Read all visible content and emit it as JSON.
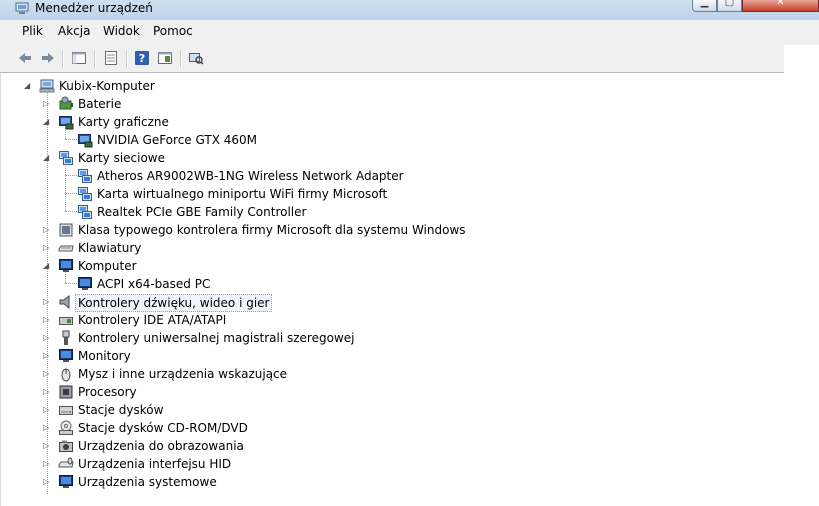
{
  "window": {
    "title": "Menedżer urządzeń"
  },
  "menu": {
    "file": "Plik",
    "action": "Akcja",
    "view": "Widok",
    "help": "Pomoc"
  },
  "toolbar": {
    "back": "back-arrow-icon",
    "forward": "forward-arrow-icon",
    "console_tree": "console-tree-icon",
    "properties": "properties-icon",
    "help": "help-icon",
    "show_hidden": "show-hidden-icon",
    "scan": "scan-hardware-icon"
  },
  "tree": {
    "root": "Kubix-Komputer",
    "categories": [
      {
        "label": "Baterie",
        "icon": "battery-icon",
        "expanded": false
      },
      {
        "label": "Karty graficzne",
        "icon": "display-adapter-icon",
        "expanded": true,
        "children": [
          {
            "label": "NVIDIA GeForce GTX 460M",
            "icon": "display-adapter-icon"
          }
        ]
      },
      {
        "label": "Karty sieciowe",
        "icon": "network-adapter-icon",
        "expanded": true,
        "children": [
          {
            "label": "Atheros AR9002WB-1NG Wireless Network Adapter",
            "icon": "network-adapter-icon"
          },
          {
            "label": "Karta wirtualnego miniportu WiFi firmy Microsoft",
            "icon": "network-adapter-icon"
          },
          {
            "label": "Realtek PCIe GBE Family Controller",
            "icon": "network-adapter-icon"
          }
        ]
      },
      {
        "label": "Klasa typowego kontrolera firmy Microsoft dla systemu Windows",
        "icon": "controller-icon",
        "expanded": false
      },
      {
        "label": "Klawiatury",
        "icon": "keyboard-icon",
        "expanded": false
      },
      {
        "label": "Komputer",
        "icon": "computer-icon",
        "expanded": true,
        "children": [
          {
            "label": "ACPI x64-based PC",
            "icon": "computer-icon"
          }
        ]
      },
      {
        "label": "Kontrolery dźwięku, wideo i gier",
        "icon": "speaker-icon",
        "expanded": false,
        "selected": true
      },
      {
        "label": "Kontrolery IDE ATA/ATAPI",
        "icon": "ide-controller-icon",
        "expanded": false
      },
      {
        "label": "Kontrolery uniwersalnej magistrali szeregowej",
        "icon": "usb-icon",
        "expanded": false
      },
      {
        "label": "Monitory",
        "icon": "monitor-icon",
        "expanded": false
      },
      {
        "label": "Mysz i inne urządzenia wskazujące",
        "icon": "mouse-icon",
        "expanded": false
      },
      {
        "label": "Procesory",
        "icon": "processor-icon",
        "expanded": false
      },
      {
        "label": "Stacje dysków",
        "icon": "disk-drive-icon",
        "expanded": false
      },
      {
        "label": "Stacje dysków CD-ROM/DVD",
        "icon": "cdrom-icon",
        "expanded": false
      },
      {
        "label": "Urządzenia do obrazowania",
        "icon": "camera-icon",
        "expanded": false
      },
      {
        "label": "Urządzenia interfejsu HID",
        "icon": "hid-icon",
        "expanded": false
      },
      {
        "label": "Urządzenia systemowe",
        "icon": "system-device-icon",
        "expanded": false
      }
    ]
  }
}
